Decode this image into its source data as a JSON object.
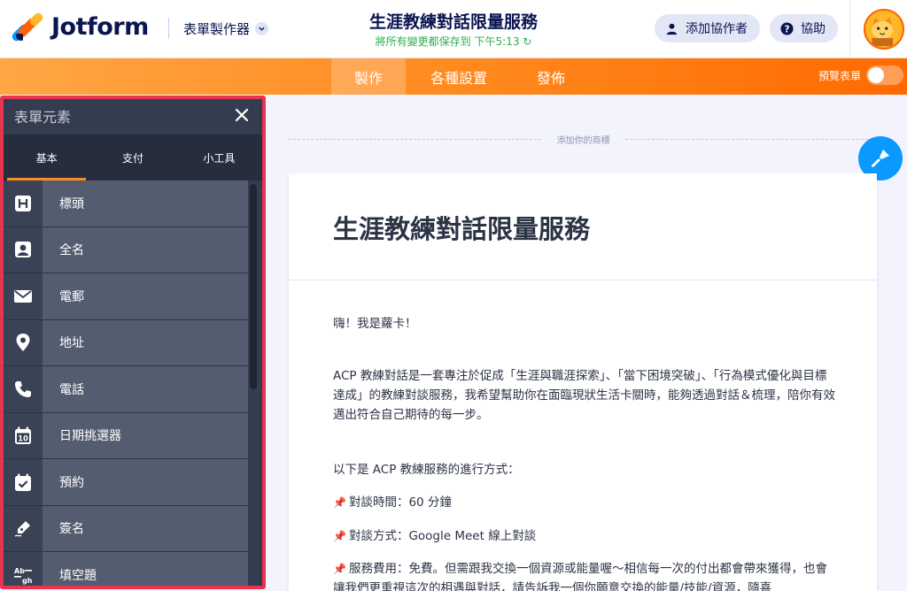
{
  "header": {
    "logo_text": "Jotform",
    "builder_label": "表單製作器",
    "form_title": "生涯教練對話限量服務",
    "saved_status": "將所有變更都保存到",
    "saved_time": "下午5:13",
    "add_collaborator": "添加協作者",
    "help": "協助"
  },
  "nav": {
    "tabs": [
      {
        "label": "製作",
        "active": true
      },
      {
        "label": "各種設置",
        "active": false
      },
      {
        "label": "發佈",
        "active": false
      }
    ],
    "preview_label": "預覽表單",
    "preview_on": false
  },
  "panel": {
    "title": "表單元素",
    "tabs": [
      {
        "label": "基本",
        "active": true
      },
      {
        "label": "支付",
        "active": false
      },
      {
        "label": "小工具",
        "active": false
      }
    ],
    "items": [
      {
        "label": "標頭",
        "icon": "heading-icon"
      },
      {
        "label": "全名",
        "icon": "person-icon"
      },
      {
        "label": "電郵",
        "icon": "email-icon"
      },
      {
        "label": "地址",
        "icon": "location-pin-icon"
      },
      {
        "label": "電話",
        "icon": "phone-icon"
      },
      {
        "label": "日期挑選器",
        "icon": "calendar-icon"
      },
      {
        "label": "預約",
        "icon": "calendar-check-icon"
      },
      {
        "label": "簽名",
        "icon": "pen-icon"
      },
      {
        "label": "填空題",
        "icon": "fill-blank-icon"
      }
    ]
  },
  "canvas": {
    "logo_placeholder": "添加你的商標",
    "form_heading": "生涯教練對話限量服務",
    "paragraphs": [
      "嗨！我是蘿卡！",
      "ACP 教練對話是一套專注於促成「生涯與職涯探索」、「當下困境突破」、「行為模式優化與目標達成」的教練對談服務，我希望幫助你在面臨現狀生活卡關時，能夠透過對話＆梳理，陪你有效邁出符合自己期待的每一步。",
      "以下是 ACP 教練服務的進行方式："
    ],
    "bullets": [
      "對談時間：60 分鐘",
      "對談方式：Google Meet 線上對談",
      "服務費用：免費。但需跟我交換一個資源或能量喔～相信每一次的付出都會帶來獲得，也會讓我們更重視這次的相遇與對話，請告訴我一個你願意交換的能量/技能/資源，隨喜"
    ]
  },
  "colors": {
    "nav_orange": "#ff8a1f",
    "panel_dark": "#343c4f",
    "highlight_red": "#e8344e",
    "fab_blue": "#0a99ff",
    "saved_green": "#2cae4e"
  }
}
